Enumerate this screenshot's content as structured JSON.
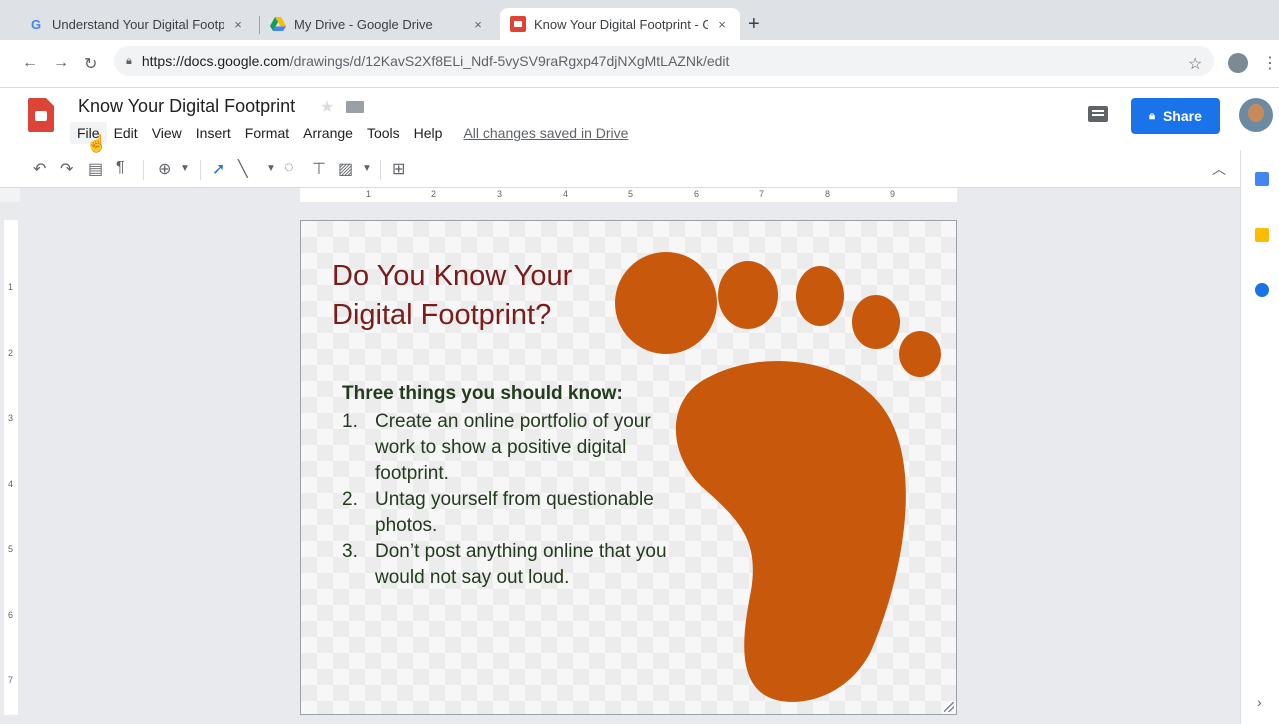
{
  "browser": {
    "tabs": [
      {
        "title": "Understand Your Digital Footp",
        "favicon": "G",
        "close": "×"
      },
      {
        "title": "My Drive - Google Drive",
        "favicon": "drive-icon",
        "close": "×"
      },
      {
        "title": "Know Your Digital Footprint - G",
        "favicon": "drawings-icon",
        "close": "×"
      }
    ],
    "new_tab": "+",
    "url_host": "https://docs.google.com",
    "url_path": "/drawings/d/12KavS2Xf8ELi_Ndf-5vySV9raRgxp47djNXgMtLAZNk/edit"
  },
  "doc": {
    "title": "Know Your Digital Footprint",
    "menus": [
      "File",
      "Edit",
      "View",
      "Insert",
      "Format",
      "Arrange",
      "Tools",
      "Help"
    ],
    "saved_status": "All changes saved in Drive",
    "share_label": "Share"
  },
  "ruler": {
    "horizontal": [
      "1",
      "2",
      "3",
      "4",
      "5",
      "6",
      "7",
      "8",
      "9"
    ],
    "vertical": [
      "1",
      "2",
      "3",
      "4",
      "5",
      "6",
      "7"
    ]
  },
  "slide": {
    "heading_line1": "Do You Know Your",
    "heading_line2": "Digital Footprint?",
    "subheading": "Three things you should know:",
    "items": [
      {
        "num": "1.",
        "text": "Create an online portfolio of your work to show a positive digital footprint."
      },
      {
        "num": "2.",
        "text": "Untag yourself from questionable photos."
      },
      {
        "num": "3.",
        "text": "Don’t post anything online that you would not say out loud."
      }
    ],
    "footprint_color": "#c8580c",
    "heading_color": "#7a1c1c",
    "body_color": "#243b1f"
  },
  "colors": {
    "share_button": "#1a73e8",
    "calendar": "#4285f4",
    "keep": "#fbbc04",
    "tasks": "#1a73e8"
  }
}
